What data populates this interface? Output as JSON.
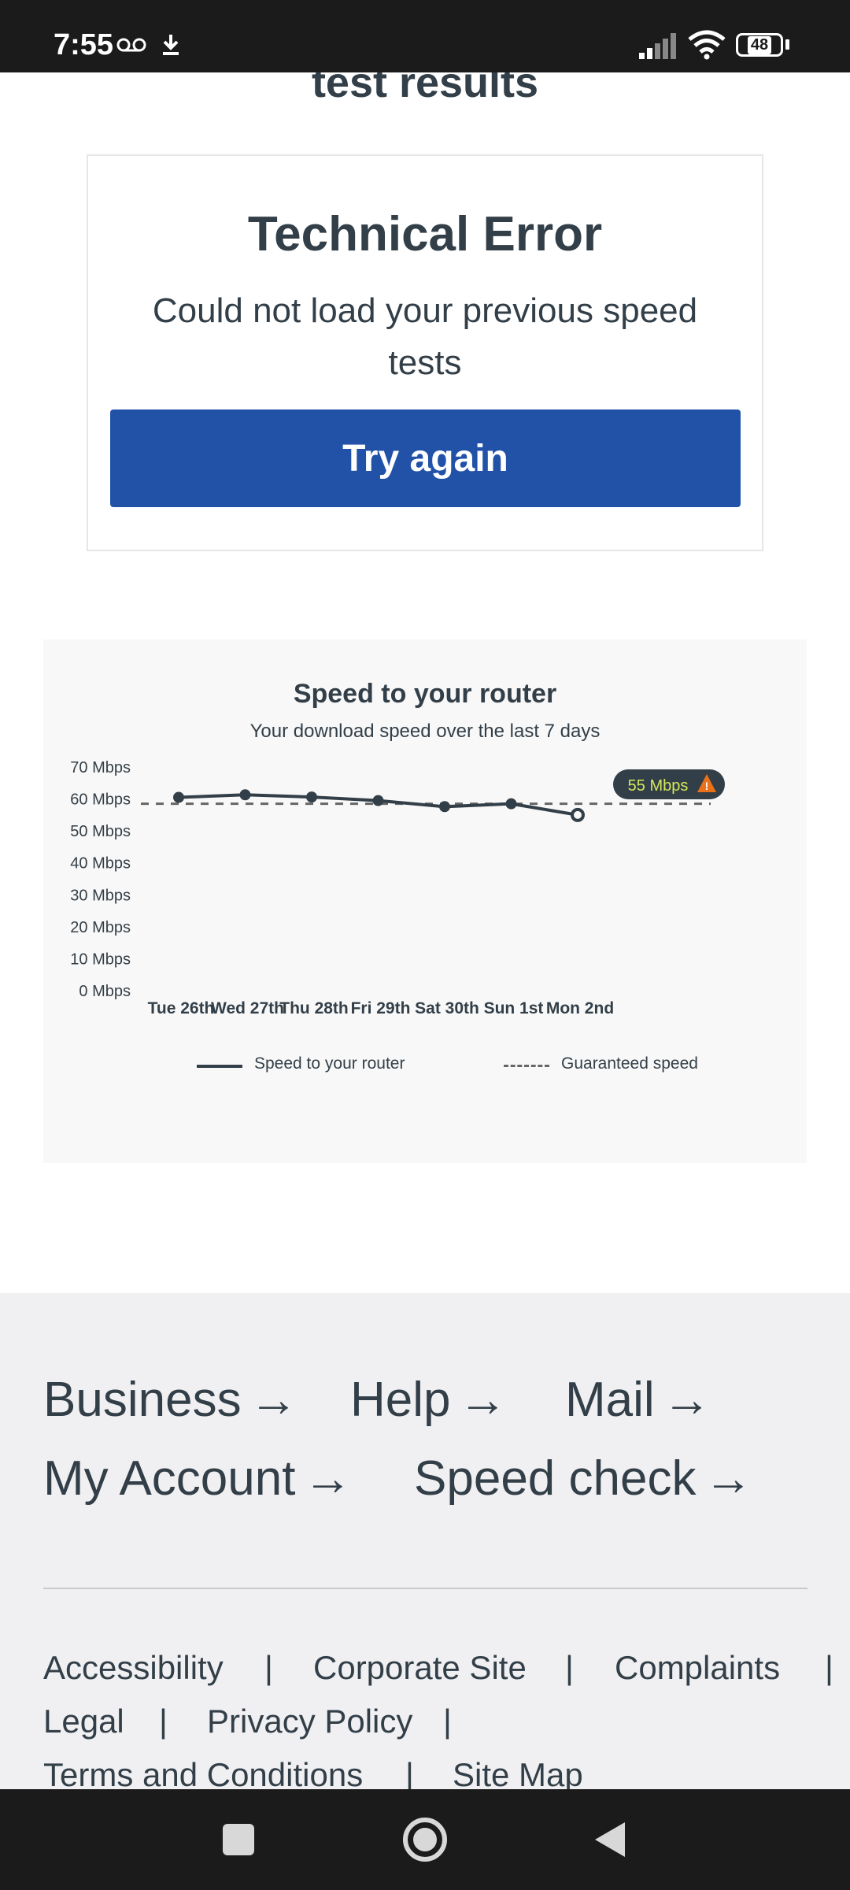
{
  "status_bar": {
    "time": "7:55",
    "battery": "48",
    "icons": [
      "voicemail-icon",
      "download-icon",
      "cellular-signal-icon",
      "wifi-icon",
      "battery-icon"
    ]
  },
  "page": {
    "partial_heading": "test results"
  },
  "error_card": {
    "title": "Technical Error",
    "message": "Could not load your previous speed tests",
    "button": "Try again",
    "button_color": "#2152a8"
  },
  "chart": {
    "title": "Speed to your router",
    "subtitle": "Your download speed over the last 7 days",
    "callout": "55 Mbps",
    "legend_router": "Speed to your router",
    "legend_guaranteed": "Guaranteed speed"
  },
  "chart_data": {
    "type": "line",
    "title": "Speed to your router",
    "subtitle": "Your download speed over the last 7 days",
    "categories": [
      "Tue 26th",
      "Wed 27th",
      "Thu 28th",
      "Fri 29th",
      "Sat 30th",
      "Sun 1st",
      "Mon 2nd"
    ],
    "y_ticks": [
      "0 Mbps",
      "10 Mbps",
      "20 Mbps",
      "30 Mbps",
      "40 Mbps",
      "50 Mbps",
      "60 Mbps",
      "70 Mbps"
    ],
    "ylim": [
      0,
      70
    ],
    "series": [
      {
        "name": "Speed to your router",
        "values": [
          60.5,
          61.3,
          60.6,
          59.5,
          57.6,
          58.5,
          55
        ],
        "color": "#333f48",
        "style": "solid"
      },
      {
        "name": "Guaranteed speed",
        "values": [
          58.5,
          58.5,
          58.5,
          58.5,
          58.5,
          58.5,
          58.5
        ],
        "color": "#666666",
        "style": "dashed"
      }
    ],
    "legend_position": "bottom",
    "grid": false
  },
  "footer": {
    "links": [
      {
        "label": "Business"
      },
      {
        "label": "Help"
      },
      {
        "label": "Mail"
      },
      {
        "label": "My Account"
      },
      {
        "label": "Speed check"
      }
    ],
    "arrow": "→",
    "small_links": [
      "Accessibility",
      "Corporate Site",
      "Complaints",
      "Legal",
      "Privacy Policy",
      "Terms and Conditions",
      "Site Map"
    ],
    "separator": "|"
  }
}
